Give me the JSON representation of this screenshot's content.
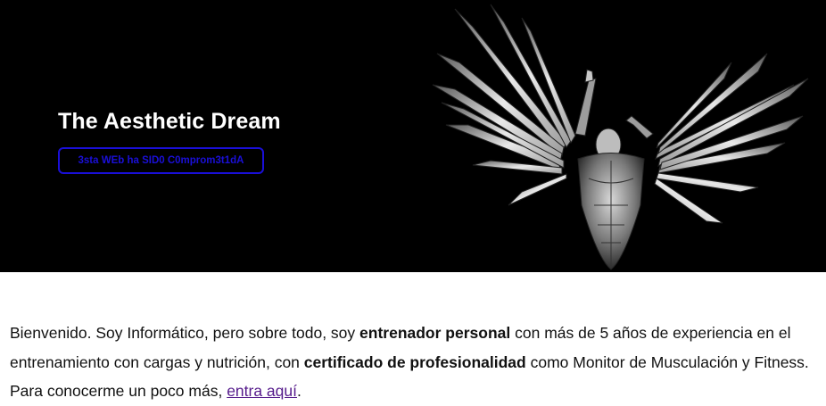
{
  "hero": {
    "title": "The Aesthetic Dream",
    "button_label": "3sta WEb ha SID0 C0mprom3t1dA",
    "image_icon": "winged-man-icon"
  },
  "intro": {
    "text1": "Bienvenido. Soy Informático, pero sobre todo, soy ",
    "bold1": "entrenador personal",
    "text2": " con más de 5 años de experiencia en el entrenamiento con cargas y nutrición, con ",
    "bold2": "certificado de profesionalidad",
    "text3": " como Monitor de Musculación y Fitness. Para conocerme un poco más, ",
    "link": "entra aquí",
    "text4": "."
  },
  "colors": {
    "hero_bg": "#000000",
    "button_accent": "#1a0fd8",
    "link": "#551a8b"
  }
}
